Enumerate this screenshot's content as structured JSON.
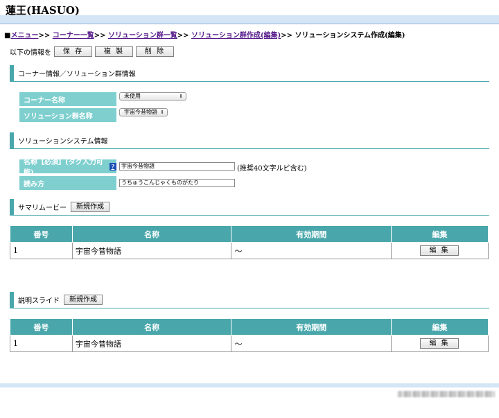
{
  "app": {
    "title": "蓮王(HASUO)"
  },
  "breadcrumb": {
    "prefix": "■",
    "items": [
      {
        "label": "メニュー"
      },
      {
        "label": "コーナー一覧"
      },
      {
        "label": "ソリューション群一覧"
      },
      {
        "label": "ソリューション群作成(編集)"
      }
    ],
    "separator": ">>",
    "current": "ソリューションシステム作成(編集)"
  },
  "actions": {
    "prompt": "以下の情報を",
    "save": "保 存",
    "copy": "複 製",
    "delete": "削 除"
  },
  "corner_section": {
    "title": "コーナー情報／ソリューション群情報",
    "corner_name_label": "コーナー名称",
    "corner_name_value": "未使用",
    "group_name_label": "ソリューション群名称",
    "group_name_value": "宇宙今昔物語"
  },
  "system_section": {
    "title": "ソリューションシステム情報",
    "name_label": "名称【必須】(タグ入力可能)",
    "help": "?",
    "name_value": "宇宙今昔物語",
    "name_hint": "(推奨40文字ルビ含む)",
    "reading_label": "読み方",
    "reading_value": "うちゅうこんじゃくものがたり"
  },
  "summary_movie": {
    "title": "サマリムービー",
    "new_button": "新規作成",
    "columns": [
      "番号",
      "名称",
      "有効期間",
      "編集"
    ],
    "rows": [
      {
        "no": "1",
        "name": "宇宙今昔物語",
        "period": "〜",
        "edit": "編 集"
      }
    ]
  },
  "slides": {
    "title": "説明スライド",
    "new_button": "新規作成",
    "columns": [
      "番号",
      "名称",
      "有効期間",
      "編集"
    ],
    "rows": [
      {
        "no": "1",
        "name": "宇宙今昔物語",
        "period": "〜",
        "edit": "編 集"
      }
    ]
  },
  "colors": {
    "accent": "#49a7ab",
    "label_bg": "#7fcfcf",
    "band": "#d4e6f6"
  }
}
